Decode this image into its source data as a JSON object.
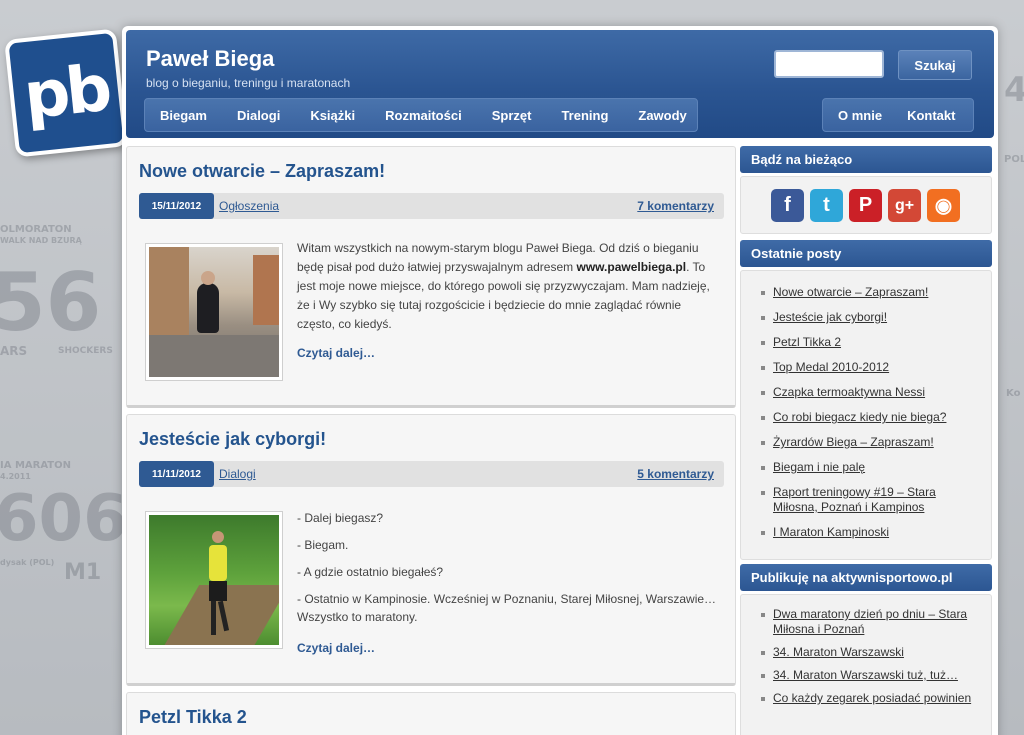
{
  "logo": {
    "text": "pb"
  },
  "header": {
    "title": "Paweł Biega",
    "tagline": "blog o bieganiu, treningu i maratonach",
    "search_label": "Szukaj",
    "search_placeholder": ""
  },
  "nav": {
    "main": [
      "Biegam",
      "Dialogi",
      "Książki",
      "Rozmaitości",
      "Sprzęt",
      "Trening",
      "Zawody"
    ],
    "side": [
      "O mnie",
      "Kontakt"
    ]
  },
  "posts": [
    {
      "title": "Nowe otwarcie – Zapraszam!",
      "date": "15/11/2012",
      "category": "Ogłoszenia",
      "comments": "7 komentarzy",
      "paragraphs": [
        "Witam wszystkich na nowym-starym blogu Paweł Biega. Od dziś o bieganiu będę pisał pod dużo łatwiej przyswajalnym adresem",
        "www.pawelbiega.pl",
        ". To jest moje nowe miejsce, do którego powoli się przyzwyczajam. Mam nadzieję, że i Wy szybko się tutaj rozgościcie i będziecie do mnie zaglądać równie często, co kiedyś."
      ],
      "read_more": "Czytaj dalej…"
    },
    {
      "title": "Jesteście jak cyborgi!",
      "date": "11/11/2012",
      "category": "Dialogi",
      "comments": "5 komentarzy",
      "paragraphs": [
        "- Dalej biegasz?",
        "- Biegam.",
        "- A gdzie ostatnio biegałeś?",
        "- Ostatnio w Kampinosie. Wcześniej w Poznaniu, Starej Miłosnej, Warszawie… Wszystko to maratony."
      ],
      "read_more": "Czytaj dalej…"
    },
    {
      "title": "Petzl Tikka 2"
    }
  ],
  "sidebar": {
    "follow_title": "Bądź na bieżąco",
    "social": [
      {
        "icon": "facebook-icon",
        "glyph": "f",
        "color": "#3b5998"
      },
      {
        "icon": "twitter-icon",
        "glyph": "t",
        "color": "#2fa7d9"
      },
      {
        "icon": "pinterest-icon",
        "glyph": "P",
        "color": "#cb2027"
      },
      {
        "icon": "googleplus-icon",
        "glyph": "g+",
        "color": "#d34836"
      },
      {
        "icon": "rss-icon",
        "glyph": "◉",
        "color": "#f26f21"
      }
    ],
    "recent_title": "Ostatnie posty",
    "recent": [
      "Nowe otwarcie – Zapraszam!",
      "Jesteście jak cyborgi!",
      "Petzl Tikka 2",
      "Top Medal 2010-2012",
      "Czapka termoaktywna Nessi",
      "Co robi biegacz kiedy nie biega?",
      "Żyrardów Biega – Zapraszam!",
      "Biegam i nie palę",
      "Raport treningowy #19 – Stara Miłosna, Poznań i Kampinos",
      "I Maraton Kampinoski"
    ],
    "publish_title": "Publikuję na aktywnisportowo.pl",
    "publish": [
      "Dwa maratony dzień po dniu – Stara Miłosna i Poznań",
      "34. Maraton Warszawski",
      "34. Maraton Warszawski tuż, tuż…",
      "Co każdy zegarek posiadać powinien"
    ]
  },
  "background_text": [
    "OLMORATON",
    "WALK NAD BZURĄ",
    "56",
    "ARS",
    "SHOCKERS",
    "IA MARATON",
    "4.2011",
    "606",
    "dysak (POL)",
    "M1",
    "4",
    "POL",
    "Ko"
  ]
}
